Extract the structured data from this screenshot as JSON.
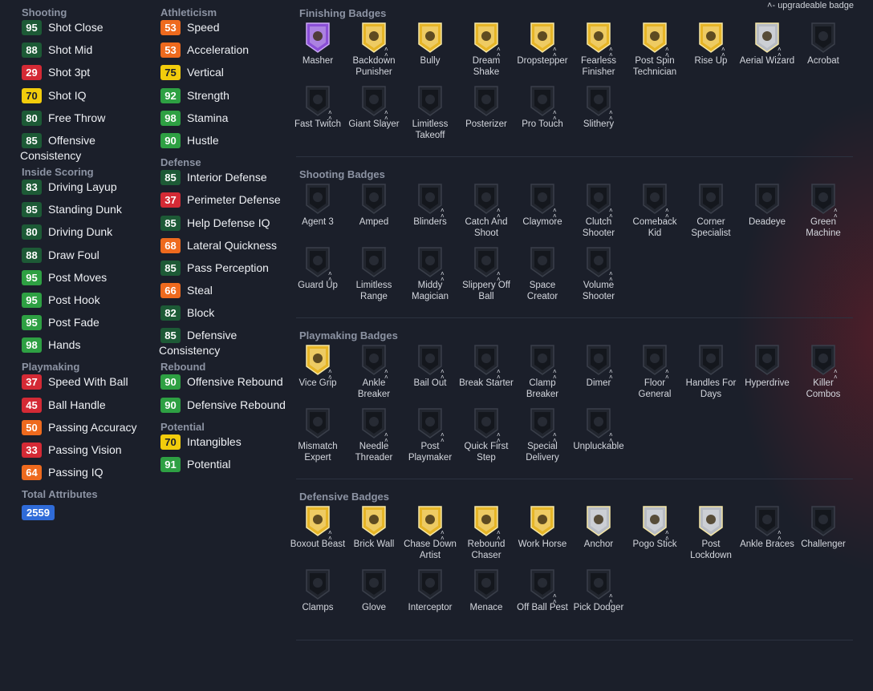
{
  "legend": {
    "icon": "upgrade-chevrons",
    "text": "- upgradeable badge"
  },
  "attributes": {
    "col1": [
      {
        "category": "Shooting",
        "items": [
          {
            "value": "95",
            "color": "green",
            "name": "Shot Close"
          },
          {
            "value": "88",
            "color": "green",
            "name": "Shot Mid"
          },
          {
            "value": "29",
            "color": "red",
            "name": "Shot 3pt"
          },
          {
            "value": "70",
            "color": "yellow",
            "name": "Shot IQ"
          },
          {
            "value": "80",
            "color": "green",
            "name": "Free Throw"
          },
          {
            "value": "85",
            "color": "green",
            "name": "Offensive Consistency",
            "wrap": true
          }
        ]
      },
      {
        "category": "Inside Scoring",
        "items": [
          {
            "value": "83",
            "color": "green",
            "name": "Driving Layup"
          },
          {
            "value": "85",
            "color": "green",
            "name": "Standing Dunk"
          },
          {
            "value": "80",
            "color": "green",
            "name": "Driving Dunk"
          },
          {
            "value": "88",
            "color": "green",
            "name": "Draw Foul"
          },
          {
            "value": "95",
            "color": "bgreen",
            "name": "Post Moves"
          },
          {
            "value": "95",
            "color": "bgreen",
            "name": "Post Hook"
          },
          {
            "value": "95",
            "color": "bgreen",
            "name": "Post Fade"
          },
          {
            "value": "98",
            "color": "bgreen",
            "name": "Hands"
          }
        ]
      },
      {
        "category": "Playmaking",
        "items": [
          {
            "value": "37",
            "color": "red",
            "name": "Speed With Ball"
          },
          {
            "value": "45",
            "color": "red",
            "name": "Ball Handle"
          },
          {
            "value": "50",
            "color": "orange",
            "name": "Passing Accuracy"
          },
          {
            "value": "33",
            "color": "red",
            "name": "Passing Vision"
          },
          {
            "value": "64",
            "color": "orange",
            "name": "Passing IQ"
          }
        ]
      },
      {
        "category": "Total Attributes",
        "total": "2559",
        "items": []
      }
    ],
    "col2": [
      {
        "category": "Athleticism",
        "items": [
          {
            "value": "53",
            "color": "orange",
            "name": "Speed"
          },
          {
            "value": "53",
            "color": "orange",
            "name": "Acceleration"
          },
          {
            "value": "75",
            "color": "yellow",
            "name": "Vertical"
          },
          {
            "value": "92",
            "color": "bgreen",
            "name": "Strength"
          },
          {
            "value": "98",
            "color": "bgreen",
            "name": "Stamina"
          },
          {
            "value": "90",
            "color": "bgreen",
            "name": "Hustle"
          }
        ]
      },
      {
        "category": "Defense",
        "items": [
          {
            "value": "85",
            "color": "green",
            "name": "Interior Defense"
          },
          {
            "value": "37",
            "color": "red",
            "name": "Perimeter Defense"
          },
          {
            "value": "85",
            "color": "green",
            "name": "Help Defense IQ"
          },
          {
            "value": "68",
            "color": "orange",
            "name": "Lateral Quickness"
          },
          {
            "value": "85",
            "color": "green",
            "name": "Pass Perception"
          },
          {
            "value": "66",
            "color": "orange",
            "name": "Steal"
          },
          {
            "value": "82",
            "color": "green",
            "name": "Block"
          },
          {
            "value": "85",
            "color": "green",
            "name": "Defensive Consistency",
            "wrap": true
          }
        ]
      },
      {
        "category": "Rebound",
        "items": [
          {
            "value": "90",
            "color": "bgreen",
            "name": "Offensive Rebound"
          },
          {
            "value": "90",
            "color": "bgreen",
            "name": "Defensive Rebound"
          }
        ]
      },
      {
        "category": "Potential",
        "items": [
          {
            "value": "70",
            "color": "yellow",
            "name": "Intangibles"
          },
          {
            "value": "91",
            "color": "bgreen",
            "name": "Potential"
          }
        ]
      }
    ]
  },
  "colors": {
    "green": "#1d5a36",
    "bgreen": "#2ea043",
    "yellow": "#f2cc0c",
    "orange": "#ee6a1e",
    "red": "#d42a35",
    "tier_hof": "#8a4fd6",
    "tier_gold": "#e6b527",
    "tier_silver": "#b8bcc4",
    "tier_none": "#22262f"
  },
  "badge_sections": [
    {
      "title": "Finishing Badges",
      "badges": [
        {
          "name": "Masher",
          "tier": "hof",
          "upgradeable": false,
          "icon": "hand-ball-icon"
        },
        {
          "name": "Backdown Punisher",
          "tier": "gold",
          "upgradeable": true,
          "icon": "prison-bars-icon"
        },
        {
          "name": "Bully",
          "tier": "gold",
          "upgradeable": false,
          "icon": "bulldog-icon"
        },
        {
          "name": "Dream Shake",
          "tier": "gold",
          "upgradeable": true,
          "icon": "hand-icon"
        },
        {
          "name": "Dropstepper",
          "tier": "gold",
          "upgradeable": true,
          "icon": "footprints-icon"
        },
        {
          "name": "Fearless Finisher",
          "tier": "gold",
          "upgradeable": true,
          "icon": "helmet-icon"
        },
        {
          "name": "Post Spin Technician",
          "tier": "gold",
          "upgradeable": true,
          "icon": "spinner-icon"
        },
        {
          "name": "Rise Up",
          "tier": "gold",
          "upgradeable": true,
          "icon": "fist-icon"
        },
        {
          "name": "Aerial Wizard",
          "tier": "silver",
          "upgradeable": true,
          "icon": "dunk-icon"
        },
        {
          "name": "Acrobat",
          "tier": "none",
          "upgradeable": false,
          "icon": "acrobat-icon"
        },
        {
          "name": "Fast Twitch",
          "tier": "none",
          "upgradeable": true,
          "icon": "runner-icon"
        },
        {
          "name": "Giant Slayer",
          "tier": "none",
          "upgradeable": true,
          "icon": "giant-icon"
        },
        {
          "name": "Limitless Takeoff",
          "tier": "none",
          "upgradeable": false,
          "icon": "takeoff-icon"
        },
        {
          "name": "Posterizer",
          "tier": "none",
          "upgradeable": false,
          "icon": "posterizer-icon"
        },
        {
          "name": "Pro Touch",
          "tier": "none",
          "upgradeable": true,
          "icon": "touch-icon"
        },
        {
          "name": "Slithery",
          "tier": "none",
          "upgradeable": true,
          "icon": "snake-icon"
        }
      ]
    },
    {
      "title": "Shooting Badges",
      "badges": [
        {
          "name": "Agent 3",
          "tier": "none",
          "upgradeable": false,
          "icon": "agent-icon"
        },
        {
          "name": "Amped",
          "tier": "none",
          "upgradeable": false,
          "icon": "amped-icon"
        },
        {
          "name": "Blinders",
          "tier": "none",
          "upgradeable": true,
          "icon": "blinders-icon"
        },
        {
          "name": "Catch And Shoot",
          "tier": "none",
          "upgradeable": true,
          "icon": "catch-icon"
        },
        {
          "name": "Claymore",
          "tier": "none",
          "upgradeable": true,
          "icon": "claymore-icon"
        },
        {
          "name": "Clutch Shooter",
          "tier": "none",
          "upgradeable": true,
          "icon": "star-icon"
        },
        {
          "name": "Comeback Kid",
          "tier": "none",
          "upgradeable": true,
          "icon": "comeback-icon"
        },
        {
          "name": "Corner Specialist",
          "tier": "none",
          "upgradeable": false,
          "icon": "corner-icon"
        },
        {
          "name": "Deadeye",
          "tier": "none",
          "upgradeable": false,
          "icon": "skull-icon"
        },
        {
          "name": "Green Machine",
          "tier": "none",
          "upgradeable": true,
          "icon": "machine-icon"
        },
        {
          "name": "Guard Up",
          "tier": "none",
          "upgradeable": true,
          "icon": "guard-icon"
        },
        {
          "name": "Limitless Range",
          "tier": "none",
          "upgradeable": false,
          "icon": "wifi-icon"
        },
        {
          "name": "Middy Magician",
          "tier": "none",
          "upgradeable": true,
          "icon": "magician-icon"
        },
        {
          "name": "Slippery Off Ball",
          "tier": "none",
          "upgradeable": true,
          "icon": "slippery-icon"
        },
        {
          "name": "Space Creator",
          "tier": "none",
          "upgradeable": false,
          "icon": "map-pin-icon"
        },
        {
          "name": "Volume Shooter",
          "tier": "none",
          "upgradeable": true,
          "icon": "bars-icon"
        }
      ]
    },
    {
      "title": "Playmaking Badges",
      "badges": [
        {
          "name": "Vice Grip",
          "tier": "gold",
          "upgradeable": true,
          "icon": "grip-icon"
        },
        {
          "name": "Ankle Breaker",
          "tier": "none",
          "upgradeable": true,
          "icon": "ankle-icon"
        },
        {
          "name": "Bail Out",
          "tier": "none",
          "upgradeable": true,
          "icon": "bag-icon"
        },
        {
          "name": "Break Starter",
          "tier": "none",
          "upgradeable": true,
          "icon": "break-icon"
        },
        {
          "name": "Clamp Breaker",
          "tier": "none",
          "upgradeable": true,
          "icon": "clamp-icon"
        },
        {
          "name": "Dimer",
          "tier": "none",
          "upgradeable": true,
          "icon": "dimer-icon"
        },
        {
          "name": "Floor General",
          "tier": "none",
          "upgradeable": true,
          "icon": "general-icon"
        },
        {
          "name": "Handles For Days",
          "tier": "none",
          "upgradeable": false,
          "icon": "battery-icon"
        },
        {
          "name": "Hyperdrive",
          "tier": "none",
          "upgradeable": false,
          "icon": "hyperdrive-icon"
        },
        {
          "name": "Killer Combos",
          "tier": "none",
          "upgradeable": true,
          "icon": "combo-icon"
        },
        {
          "name": "Mismatch Expert",
          "tier": "none",
          "upgradeable": false,
          "icon": "mismatch-icon"
        },
        {
          "name": "Needle Threader",
          "tier": "none",
          "upgradeable": true,
          "icon": "needle-icon"
        },
        {
          "name": "Post Playmaker",
          "tier": "none",
          "upgradeable": true,
          "icon": "post-icon"
        },
        {
          "name": "Quick First Step",
          "tier": "none",
          "upgradeable": true,
          "icon": "step-icon"
        },
        {
          "name": "Special Delivery",
          "tier": "none",
          "upgradeable": true,
          "icon": "delivery-icon"
        },
        {
          "name": "Unpluckable",
          "tier": "none",
          "upgradeable": true,
          "icon": "unpluck-icon"
        }
      ]
    },
    {
      "title": "Defensive Badges",
      "badges": [
        {
          "name": "Boxout Beast",
          "tier": "gold",
          "upgradeable": true,
          "icon": "boxout-icon"
        },
        {
          "name": "Brick Wall",
          "tier": "gold",
          "upgradeable": false,
          "icon": "brick-wall-icon"
        },
        {
          "name": "Chase Down Artist",
          "tier": "gold",
          "upgradeable": true,
          "icon": "shield-star-icon"
        },
        {
          "name": "Rebound Chaser",
          "tier": "gold",
          "upgradeable": true,
          "icon": "rebound-icon"
        },
        {
          "name": "Work Horse",
          "tier": "gold",
          "upgradeable": false,
          "icon": "horse-icon"
        },
        {
          "name": "Anchor",
          "tier": "silver",
          "upgradeable": false,
          "icon": "anchor-icon"
        },
        {
          "name": "Pogo Stick",
          "tier": "silver",
          "upgradeable": true,
          "icon": "pogo-icon"
        },
        {
          "name": "Post Lockdown",
          "tier": "silver",
          "upgradeable": false,
          "icon": "lock-icon"
        },
        {
          "name": "Ankle Braces",
          "tier": "none",
          "upgradeable": true,
          "icon": "boot-icon"
        },
        {
          "name": "Challenger",
          "tier": "none",
          "upgradeable": false,
          "icon": "challenger-icon"
        },
        {
          "name": "Clamps",
          "tier": "none",
          "upgradeable": false,
          "icon": "clamps-icon"
        },
        {
          "name": "Glove",
          "tier": "none",
          "upgradeable": false,
          "icon": "glove-icon"
        },
        {
          "name": "Interceptor",
          "tier": "none",
          "upgradeable": false,
          "icon": "jet-icon"
        },
        {
          "name": "Menace",
          "tier": "none",
          "upgradeable": false,
          "icon": "menace-icon"
        },
        {
          "name": "Off Ball Pest",
          "tier": "none",
          "upgradeable": true,
          "icon": "pest-icon"
        },
        {
          "name": "Pick Dodger",
          "tier": "none",
          "upgradeable": true,
          "icon": "dodger-icon"
        }
      ]
    }
  ]
}
